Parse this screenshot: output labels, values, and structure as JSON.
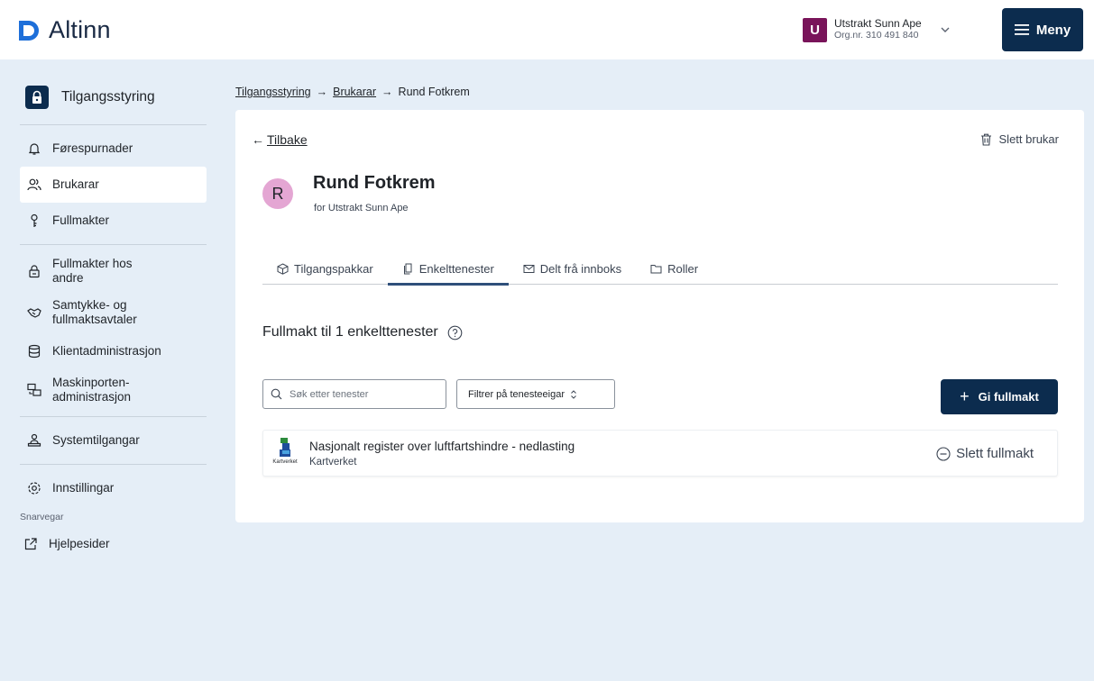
{
  "header": {
    "logo_text": "Altinn",
    "account_initial": "U",
    "account_name": "Utstrakt Sunn Ape",
    "account_org": "Org.nr. 310 491 840",
    "menu_label": "Meny"
  },
  "sidebar": {
    "top_label": "Tilgangsstyring",
    "items": [
      {
        "label": "Førespurnader",
        "icon": "bell-icon"
      },
      {
        "label": "Brukarar",
        "icon": "users-icon",
        "active": true
      },
      {
        "label": "Fullmakter",
        "icon": "key-icon"
      },
      {
        "label": "Fullmakter hos andre",
        "icon": "padlock-icon"
      },
      {
        "label": "Samtykke- og fullmaktsavtaler",
        "icon": "handshake-icon"
      },
      {
        "label": "Klientadministrasjon",
        "icon": "database-icon"
      },
      {
        "label": "Maskinporten-administrasjon",
        "icon": "monitors-icon"
      },
      {
        "label": "Systemtilgangar",
        "icon": "person-desk-icon"
      },
      {
        "label": "Innstillingar",
        "icon": "gear-icon"
      }
    ],
    "shortcuts_label": "Snarvegar",
    "help_label": "Hjelpesider"
  },
  "breadcrumb": {
    "items": [
      "Tilgangsstyring",
      "Brukarar",
      "Rund Fotkrem"
    ],
    "separator": "→"
  },
  "card": {
    "back_label": "Tilbake",
    "delete_user_label": "Slett brukar",
    "user_initial": "R",
    "user_name": "Rund Fotkrem",
    "user_for": "for Utstrakt Sunn Ape",
    "tabs": [
      {
        "label": "Tilgangspakkar",
        "icon": "package-icon"
      },
      {
        "label": "Enkelttenester",
        "icon": "documents-icon",
        "active": true
      },
      {
        "label": "Delt frå innboks",
        "icon": "envelope-icon"
      },
      {
        "label": "Roller",
        "icon": "folder-icon"
      }
    ],
    "section_title": "Fullmakt til 1 enkelttenester",
    "search_placeholder": "Søk etter tenester",
    "filter_label": "Filtrer på tenesteeigar",
    "give_button": "Gi fullmakt",
    "services": [
      {
        "title": "Nasjonalt register over luftfartshindre - nedlasting",
        "owner": "Kartverket",
        "logo_caption": "Kartverket",
        "delete_label": "Slett fullmakt"
      }
    ]
  },
  "colors": {
    "brand_dark": "#0c2c4e",
    "logo_blue": "#1e6fd9",
    "account_avatar": "#79145a",
    "user_avatar": "#e4a6d3",
    "page_bg": "#e5eef7"
  }
}
